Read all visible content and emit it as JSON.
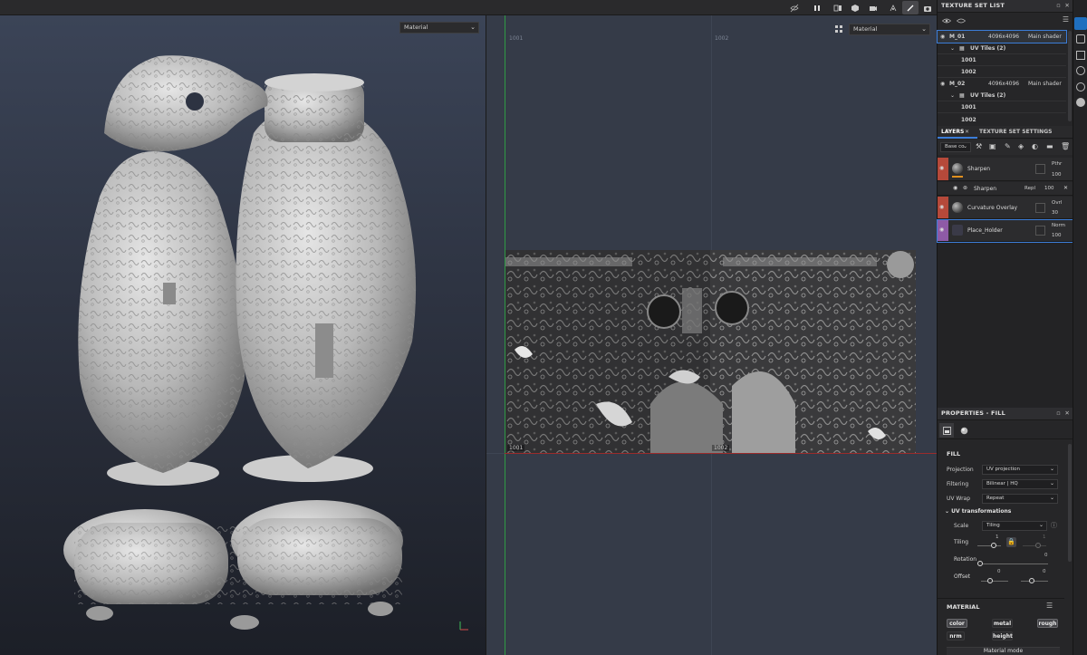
{
  "toolbar": {
    "icons": [
      "visibility-off-icon",
      "pause-icon",
      "view-mode-icon",
      "object-icon",
      "camera-icon",
      "symmetry-icon",
      "brush-icon",
      "screenshot-icon"
    ]
  },
  "viewport3d": {
    "dropdown": "Material"
  },
  "viewport2d": {
    "dropdown": "Material",
    "uv_labels": [
      "1001",
      "1002"
    ],
    "tile_labels": [
      "1001",
      "1002"
    ]
  },
  "texture_set_list": {
    "title": "TEXTURE SET LIST",
    "sets": [
      {
        "name": "M_01",
        "resolution": "4096x4096",
        "shader": "Main shader",
        "uv_tiles_label": "UV Tiles (2)",
        "tiles": [
          "1001",
          "1002"
        ]
      },
      {
        "name": "M_02",
        "resolution": "4096x4096",
        "shader": "Main shader",
        "uv_tiles_label": "UV Tiles (2)",
        "tiles": [
          "1001",
          "1002"
        ]
      }
    ]
  },
  "layers_panel": {
    "tabs": [
      "LAYERS",
      "TEXTURE SET SETTINGS"
    ],
    "channel_select": "Base co",
    "layers": [
      {
        "name": "Sharpen",
        "blend": "Pthr",
        "opacity": "100",
        "color": "#b5493a"
      },
      {
        "name": "Sharpen",
        "blend": "Repl",
        "opacity": "100",
        "is_effect": true
      },
      {
        "name": "Curvature Overlay",
        "blend": "Ovrl",
        "opacity": "30",
        "color": "#b5493a"
      },
      {
        "name": "Place_Holder",
        "blend": "Norm",
        "opacity": "100",
        "color": "#8e5aa6"
      }
    ]
  },
  "properties": {
    "title": "PROPERTIES - FILL",
    "section": "FILL",
    "rows": [
      {
        "label": "Projection",
        "value": "UV projection"
      },
      {
        "label": "Filtering",
        "value": "Bilinear | HQ"
      },
      {
        "label": "UV Wrap",
        "value": "Repeat"
      }
    ],
    "uv_transformations": {
      "title": "UV transformations",
      "scale_label": "Scale",
      "scale_value": "Tiling",
      "tiling_label": "Tiling",
      "tiling_values": [
        "1",
        "1"
      ],
      "rotation_label": "Rotation",
      "rotation_value": "0",
      "offset_label": "Offset",
      "offset_values": [
        "0",
        "0"
      ]
    },
    "material": {
      "title": "MATERIAL",
      "channels": [
        {
          "label": "color",
          "enabled": true
        },
        {
          "label": "metal",
          "enabled": false
        },
        {
          "label": "rough",
          "enabled": true
        },
        {
          "label": "nrm",
          "enabled": false
        },
        {
          "label": "height",
          "enabled": false
        }
      ],
      "mode_label": "Material mode"
    }
  }
}
